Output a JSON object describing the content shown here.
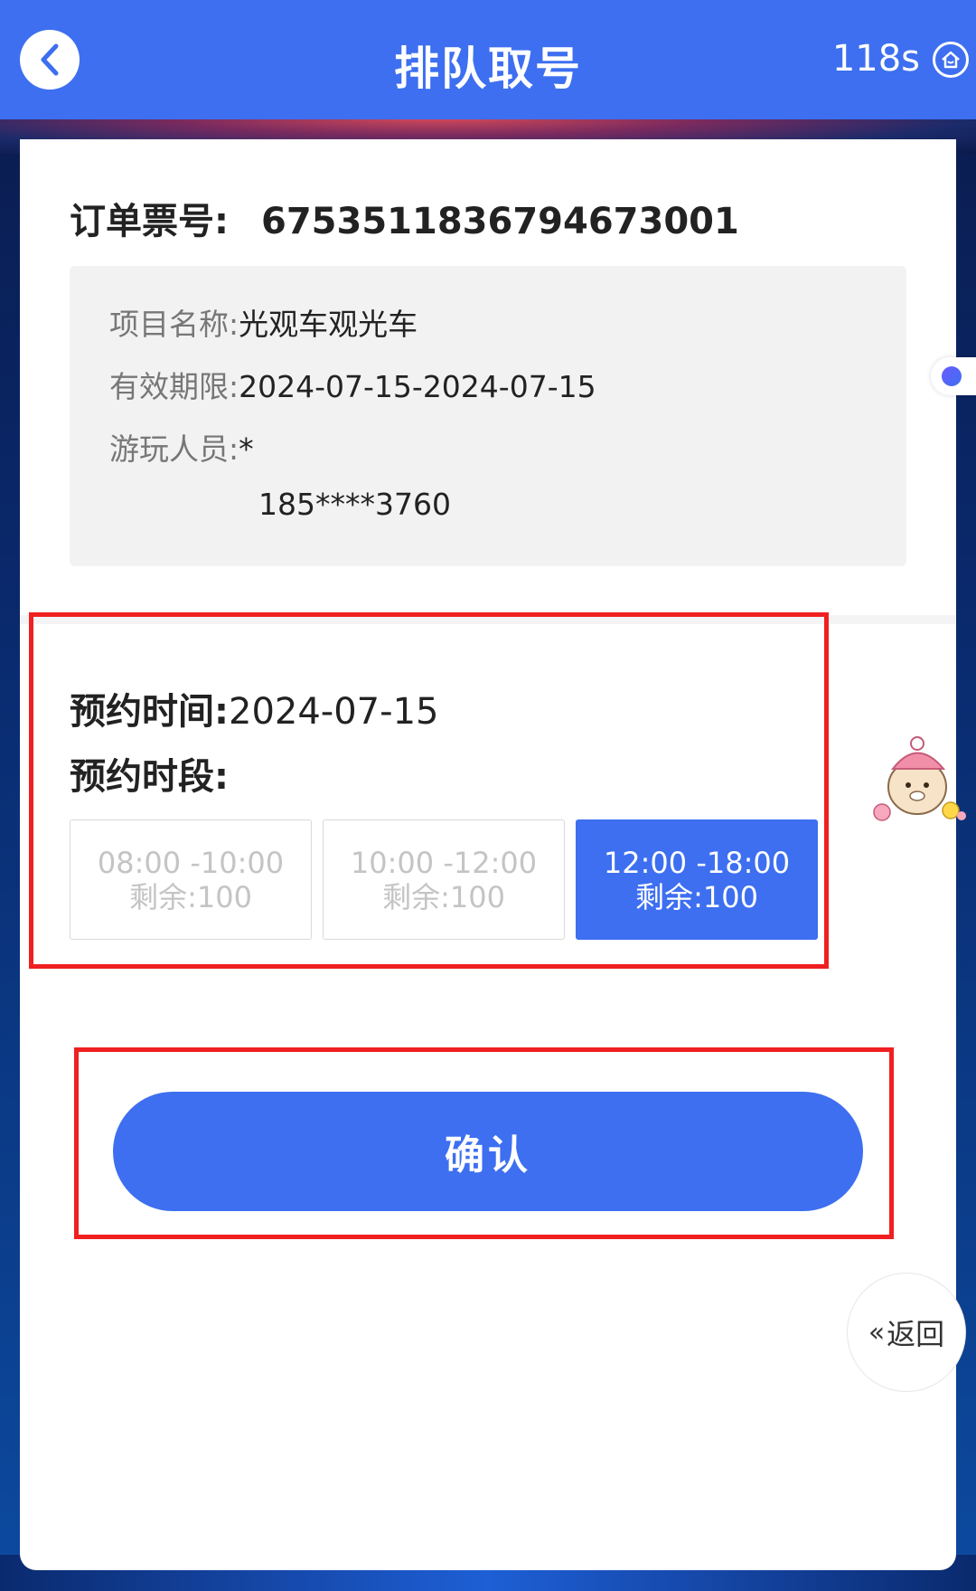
{
  "header": {
    "title": "排队取号",
    "timer": "118s"
  },
  "order": {
    "label": "订单票号:",
    "number": "6753511836794673001"
  },
  "info": {
    "project_label": "项目名称:",
    "project_value": "光观车观光车",
    "validity_label": "有效期限:",
    "validity_value": "2024-07-15-2024-07-15",
    "visitor_label": "游玩人员:",
    "visitor_name": "*",
    "visitor_phone": "185****3760"
  },
  "appointment": {
    "date_label": "预约时间:",
    "date_value": "2024-07-15",
    "slot_label": "预约时段:",
    "slots": [
      {
        "time": "08:00 -10:00",
        "remaining": "剩余:100",
        "state": "disabled"
      },
      {
        "time": "10:00 -12:00",
        "remaining": "剩余:100",
        "state": "disabled"
      },
      {
        "time": "12:00 -18:00",
        "remaining": "剩余:100",
        "state": "selected"
      }
    ]
  },
  "actions": {
    "confirm_label": "确认",
    "return_label": "返回",
    "return_arrows": "«"
  },
  "colors": {
    "primary": "#3d6ff0",
    "annotation": "#f02020"
  }
}
